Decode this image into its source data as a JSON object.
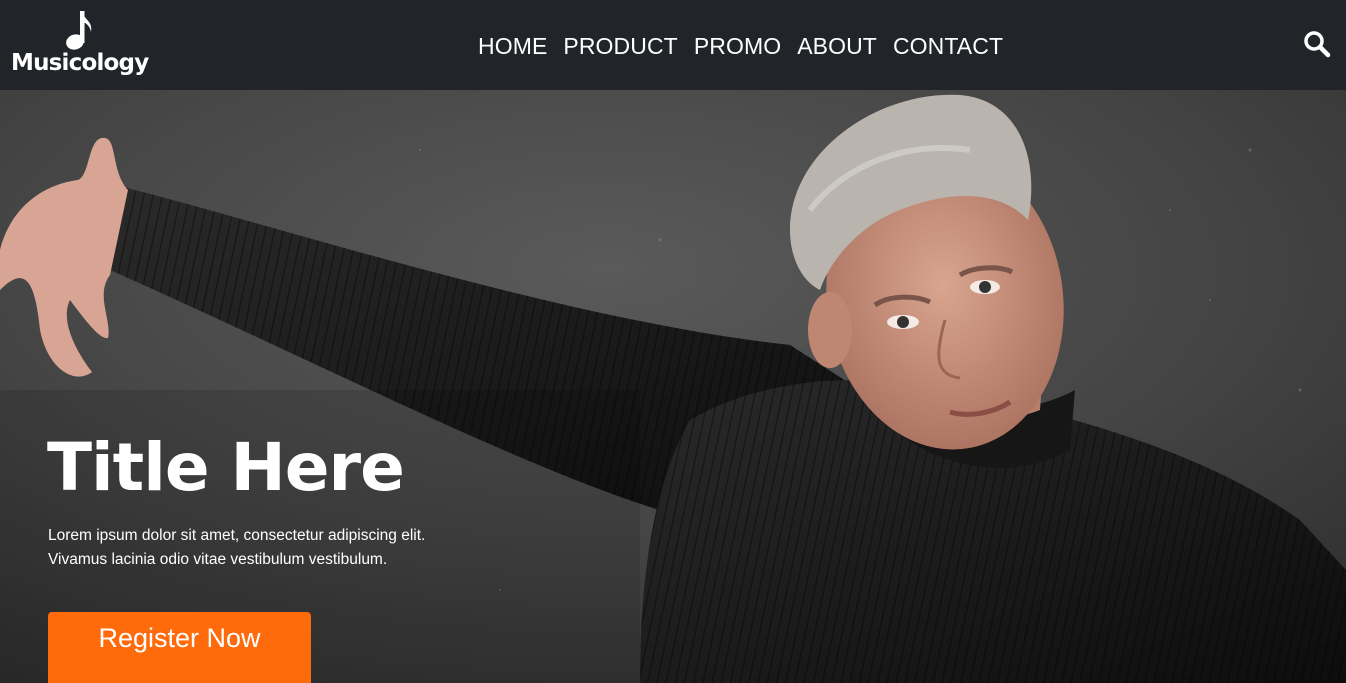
{
  "brand": {
    "name": "Musicology",
    "logo_icon": "music-note-icon"
  },
  "nav": {
    "items": [
      "HOME",
      "PRODUCT",
      "PROMO",
      "ABOUT",
      "CONTACT"
    ],
    "search_icon": "search-icon"
  },
  "hero": {
    "title": "Title Here",
    "text": "Lorem ipsum dolor sit amet, consectetur adipiscing elit. Vivamus lacinia odio vitae vestibulum vestibulum.",
    "button_label": "Register Now"
  },
  "colors": {
    "navbar_bg": "#212429",
    "accent": "#ff6a0b",
    "text": "#ffffff"
  }
}
